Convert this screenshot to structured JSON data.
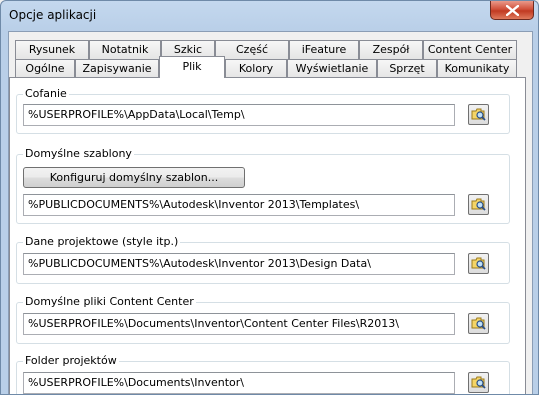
{
  "window": {
    "title": "Opcje aplikacji"
  },
  "tabs": {
    "row_back": [
      "Rysunek",
      "Notatnik",
      "Szkic",
      "Część",
      "iFeature",
      "Zespół",
      "Content Center"
    ],
    "row_front": [
      "Ogólne",
      "Zapisywanie",
      "Plik",
      "Kolory",
      "Wyświetlanie",
      "Sprzęt",
      "Komunikaty"
    ],
    "active": "Plik"
  },
  "groups": [
    {
      "label": "Cofanie",
      "path": "%USERPROFILE%\\AppData\\Local\\Temp\\"
    },
    {
      "label": "Domyślne szablony",
      "button": "Konfiguruj domyślny szablon...",
      "path": "%PUBLICDOCUMENTS%\\Autodesk\\Inventor 2013\\Templates\\"
    },
    {
      "label": "Dane projektowe (style itp.)",
      "path": "%PUBLICDOCUMENTS%\\Autodesk\\Inventor 2013\\Design Data\\"
    },
    {
      "label": "Domyślne pliki Content Center",
      "path": "%USERPROFILE%\\Documents\\Inventor\\Content Center Files\\R2013\\"
    },
    {
      "label": "Folder projektów",
      "path": "%USERPROFILE%\\Documents\\Inventor\\"
    }
  ],
  "icons": {
    "close": "close-icon",
    "browse": "folder-browse-icon"
  },
  "colors": {
    "titlebar": "#b9cfe8",
    "close_button": "#c13a22"
  }
}
